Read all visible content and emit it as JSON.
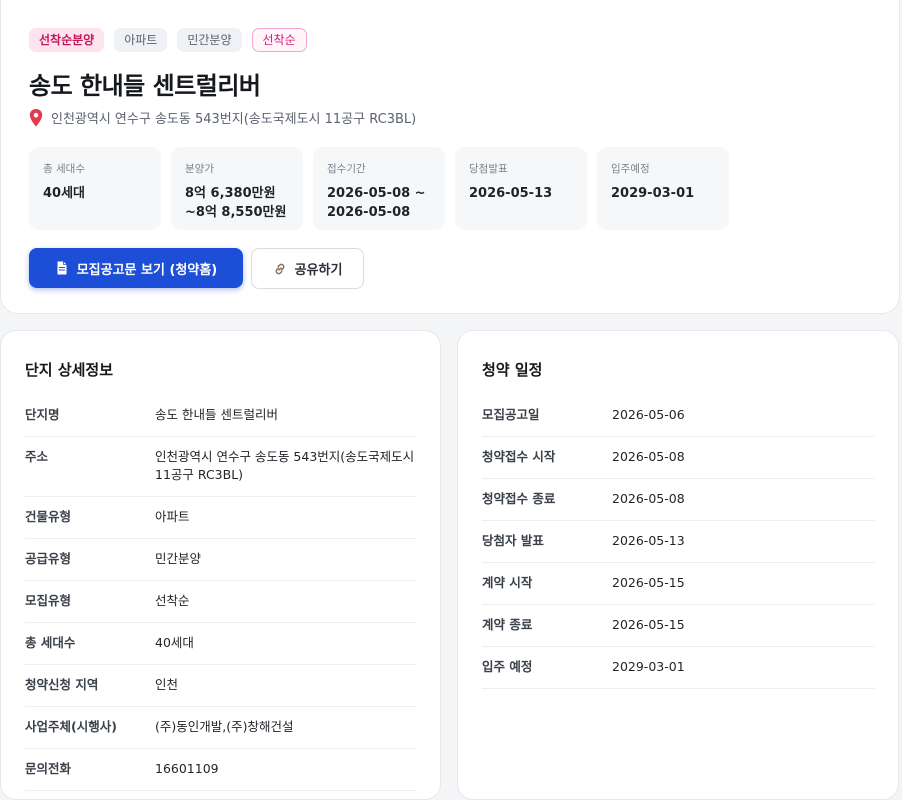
{
  "badges": [
    "선착순분양",
    "아파트",
    "민간분양",
    "선착순"
  ],
  "title": "송도 한내들 센트럴리버",
  "address": "인천광역시 연수구 송도동 543번지(송도국제도시 11공구 RC3BL)",
  "stats": [
    {
      "label": "총 세대수",
      "value": "40세대"
    },
    {
      "label": "분양가",
      "value": "8억 6,380만원\n~8억 8,550만원"
    },
    {
      "label": "접수기간",
      "value": "2026-05-08 ~\n2026-05-08"
    },
    {
      "label": "당첨발표",
      "value": "2026-05-13"
    },
    {
      "label": "입주예정",
      "value": "2029-03-01"
    }
  ],
  "buttons": {
    "notice": "모집공고문 보기 (청약홈)",
    "share": "공유하기"
  },
  "detail": {
    "title": "단지 상세정보",
    "rows": [
      {
        "label": "단지명",
        "value": "송도 한내들 센트럴리버"
      },
      {
        "label": "주소",
        "value": "인천광역시 연수구 송도동 543번지(송도국제도시 11공구 RC3BL)"
      },
      {
        "label": "건물유형",
        "value": "아파트"
      },
      {
        "label": "공급유형",
        "value": "민간분양"
      },
      {
        "label": "모집유형",
        "value": "선착순"
      },
      {
        "label": "총 세대수",
        "value": "40세대"
      },
      {
        "label": "청약신청 지역",
        "value": "인천"
      },
      {
        "label": "사업주체(시행사)",
        "value": "(주)동인개발,(주)창해건설"
      },
      {
        "label": "문의전화",
        "value": "16601109"
      }
    ]
  },
  "schedule": {
    "title": "청약 일정",
    "rows": [
      {
        "label": "모집공고일",
        "value": "2026-05-06"
      },
      {
        "label": "청약접수 시작",
        "value": "2026-05-08"
      },
      {
        "label": "청약접수 종료",
        "value": "2026-05-08"
      },
      {
        "label": "당첨자 발표",
        "value": "2026-05-13"
      },
      {
        "label": "계약 시작",
        "value": "2026-05-15"
      },
      {
        "label": "계약 종료",
        "value": "2026-05-15"
      },
      {
        "label": "입주 예정",
        "value": "2029-03-01"
      }
    ]
  },
  "colors": {
    "accent": "#1d4ed8",
    "badge_pink": "#c2185b",
    "pin": "#e53950"
  },
  "icons": {
    "pin": "map-pin-icon",
    "notice": "document-icon",
    "share": "link-icon"
  }
}
